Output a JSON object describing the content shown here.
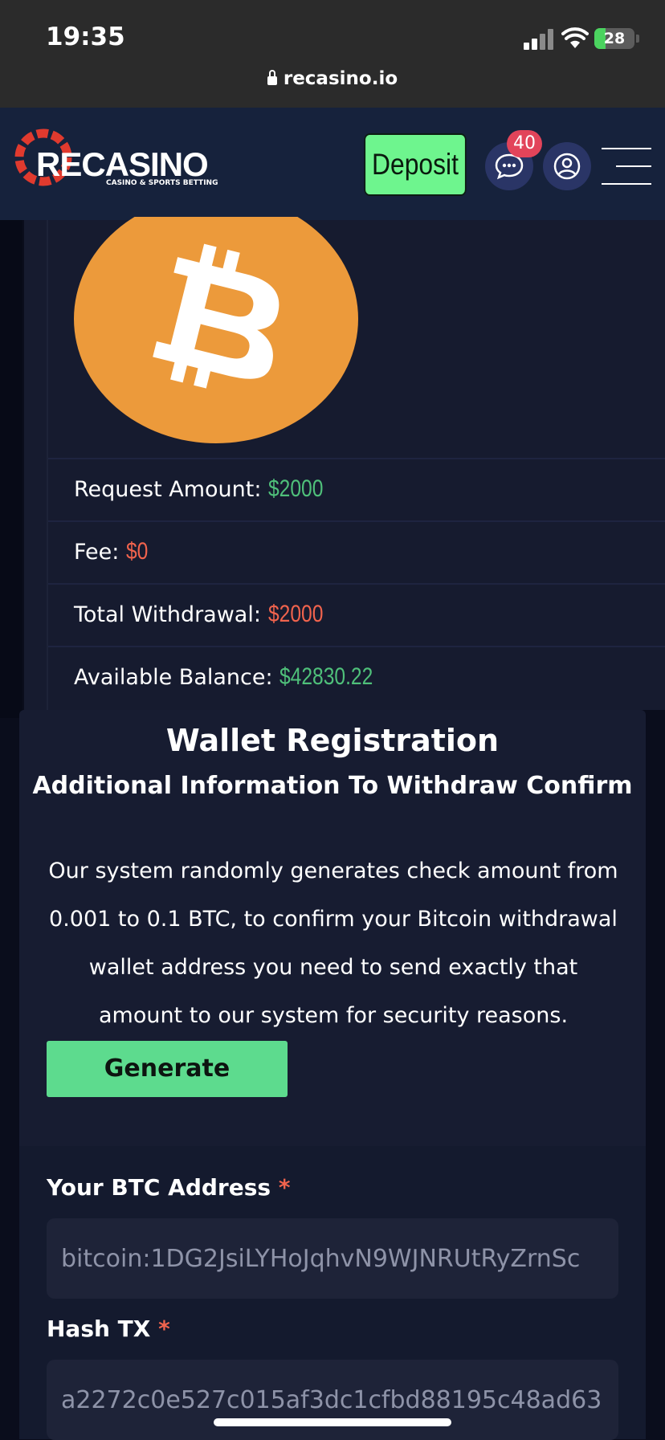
{
  "status_bar": {
    "time": "19:35",
    "battery": "28",
    "battery_level": 0.28,
    "url": "recasino.io"
  },
  "header": {
    "logo_text": "RECASINO",
    "logo_tagline": "CASINO & SPORTS BETTING",
    "deposit_label": "Deposit",
    "notification_count": "40",
    "colors": {
      "deposit": "#6ef58e",
      "badge": "#e2445a",
      "header_bg": "#16223c"
    }
  },
  "summary": {
    "coin_icon": "bitcoin-icon",
    "request_amount_label": "Request Amount:",
    "request_amount_value": "$2000",
    "fee_label": "Fee:",
    "fee_value": "$0",
    "total_label": "Total Withdrawal:",
    "total_value": "$2000",
    "balance_label": "Available Balance:",
    "balance_value": "$42830.22",
    "colors": {
      "positive": "#4fc07a",
      "negative": "#f0634d"
    }
  },
  "wallet": {
    "title": "Wallet Registration",
    "subtitle": "Additional Information To Withdraw Confirm",
    "description": "Our system randomly generates check amount from 0.001 to 0.1 BTC, to confirm your Bitcoin withdrawal wallet address you need to send exactly that amount to our system for security reasons.",
    "generate_label": "Generate"
  },
  "form": {
    "btc_address_label": "Your BTC Address",
    "btc_address_placeholder": "bitcoin:1DG2JsiLYHoJqhvN9WJNRUtRyZrnSc",
    "hash_label": "Hash TX",
    "hash_placeholder": "a2272c0e527c015af3dc1cfbd88195c48ad63",
    "required_mark": "*"
  }
}
